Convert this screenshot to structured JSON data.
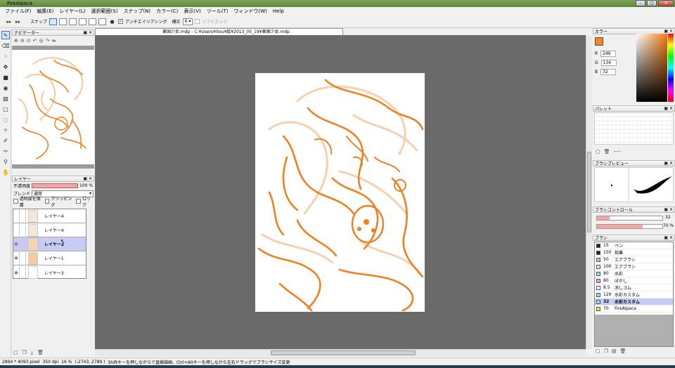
{
  "window": {
    "title": "FireAlpaca"
  },
  "menu": [
    "ファイル(F)",
    "編集(E)",
    "レイヤー(L)",
    "選択範囲(S)",
    "スナップ(N)",
    "カラー(C)",
    "表示(V)",
    "ツール(T)",
    "ウィンドウ(W)",
    "Help"
  ],
  "toolbar": {
    "snap_label": "スナップ",
    "antialias_label": "アンチエイリアシング",
    "correction_label": "補正",
    "correction_value": "6",
    "soft_edge_label": "ソフトエッジ"
  },
  "navigator": {
    "title": "ナビゲーター"
  },
  "layers": {
    "title": "レイヤー",
    "opacity_label": "不透明度",
    "opacity_value": "100 %",
    "blend_label": "ブレンド",
    "blend_value": "通常",
    "protect_alpha": "透明度を保護",
    "clipping": "クリッピング",
    "lock": "ロック",
    "items": [
      {
        "name": "レイヤー4",
        "selected": false
      },
      {
        "name": "レイヤー4",
        "selected": false
      },
      {
        "name": "レイヤー2",
        "selected": true
      },
      {
        "name": "レイヤー1",
        "selected": false
      },
      {
        "name": "レイヤー3",
        "selected": false
      }
    ]
  },
  "document": {
    "tab_title": "東国少女.mdp - C:¥Users¥itou¥絵¥2013_05_19¥東国少女.mdp"
  },
  "color": {
    "title": "カラー",
    "r": "246",
    "g": "134",
    "b": "32",
    "current_hex": "#f68620"
  },
  "palette": {
    "title": "パレット",
    "dash": "----"
  },
  "brush_preview": {
    "title": "ブラシプレビュー"
  },
  "brush_control": {
    "title": "ブラシコントロール",
    "size_value": "32",
    "opacity_value": "70 %",
    "size_fraction": 0.19,
    "opacity_fraction": 0.7
  },
  "brushes": {
    "title": "ブラシ",
    "items": [
      {
        "size": "15",
        "name": "ペン",
        "color": "#222222",
        "selected": false
      },
      {
        "size": "150",
        "name": "鉛筆",
        "color": "#222222",
        "selected": false
      },
      {
        "size": "50",
        "name": "エアブラシ",
        "color": "#c0c0c0",
        "selected": false
      },
      {
        "size": "100",
        "name": "エアブラシ",
        "color": "#e0e0e0",
        "selected": false
      },
      {
        "size": "80",
        "name": "水彩",
        "color": "#8fe0f0",
        "selected": false
      },
      {
        "size": "80",
        "name": "ぼかし",
        "color": "#e8a0e8",
        "selected": false
      },
      {
        "size": "8.5",
        "name": "消しゴム",
        "color": "#ffffff",
        "selected": false
      },
      {
        "size": "129",
        "name": "水彩カスタム",
        "color": "#8fe0f0",
        "selected": false
      },
      {
        "size": "32",
        "name": "水彩カスタム",
        "color": "#8fe0f0",
        "selected": true
      },
      {
        "size": "70",
        "name": "FireAlpaca",
        "color": "#f0e020",
        "selected": false
      }
    ]
  },
  "status": {
    "dimensions": "2894 * 4093 pixel",
    "dpi": "350 dpi",
    "zoom": "16 %",
    "coords": "(-2743, 2789 )",
    "hint": "Shiftキーを押しながらで直線描画、Ctrl+Altキーを押しながら左右ドラッグでブラシサイズ変更"
  }
}
